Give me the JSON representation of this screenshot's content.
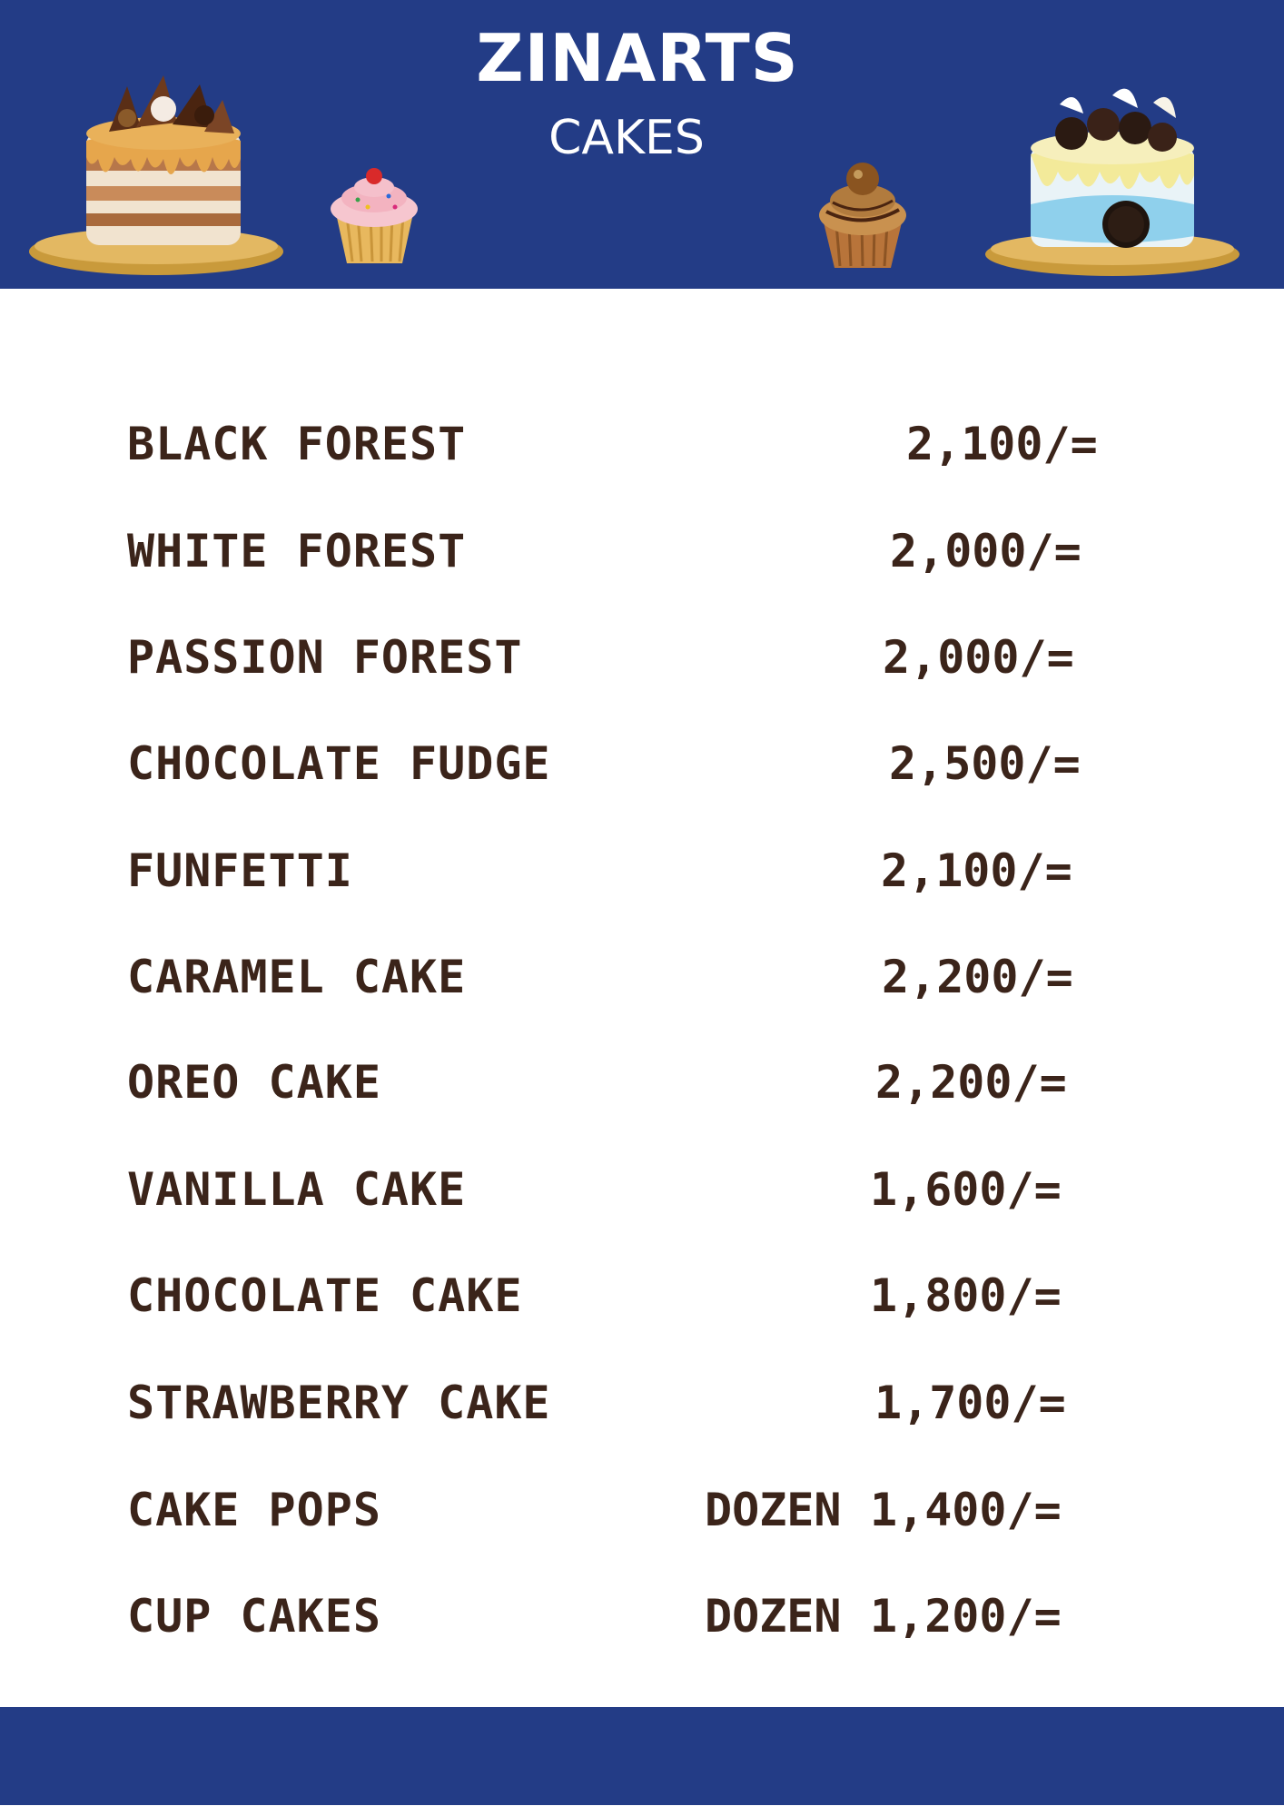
{
  "header": {
    "brand_name": "ZINARTS",
    "brand_sub": "CAKES"
  },
  "colors": {
    "brand_blue": "#233c86",
    "text_brown": "#3b241a"
  },
  "menu": {
    "items": [
      {
        "name": "BLACK FOREST",
        "price": "2,100/="
      },
      {
        "name": "WHITE FOREST",
        "price": "2,000/="
      },
      {
        "name": "PASSION FOREST",
        "price": "2,000/="
      },
      {
        "name": "CHOCOLATE FUDGE",
        "price": "2,500/="
      },
      {
        "name": "FUNFETTI",
        "price": "2,100/="
      },
      {
        "name": "CARAMEL CAKE",
        "price": "2,200/="
      },
      {
        "name": "OREO CAKE",
        "price": "2,200/="
      },
      {
        "name": "VANILLA CAKE",
        "price": "1,600/="
      },
      {
        "name": "CHOCOLATE CAKE",
        "price": "1,800/="
      },
      {
        "name": "STRAWBERRY CAKE",
        "price": "1,700/="
      },
      {
        "name": "CAKE POPS",
        "unit": "DOZEN",
        "price": "1,400/="
      },
      {
        "name": "CUP CAKES",
        "unit": "DOZEN",
        "price": "1,200/="
      }
    ]
  },
  "illustrations": [
    "drip-cake-image",
    "cupcake-image",
    "chocolate-cupcake-image",
    "oreo-cake-image"
  ]
}
